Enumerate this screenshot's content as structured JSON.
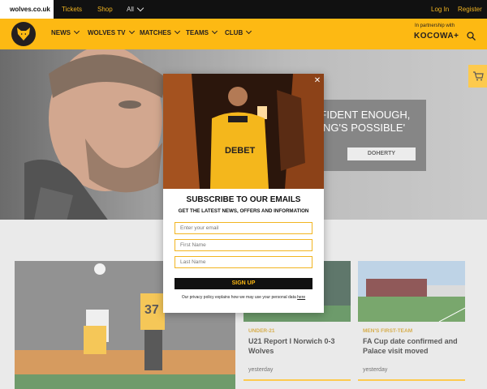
{
  "topbar": {
    "site": "wolves.co.uk",
    "links": [
      "Tickets",
      "Shop",
      "All"
    ],
    "login": "Log In",
    "register": "Register"
  },
  "nav": {
    "items": [
      "NEWS",
      "WOLVES TV",
      "MATCHES",
      "TEAMS",
      "CLUB"
    ],
    "partner_text": "In partnership with",
    "partner_name": "KOCOWA+",
    "icons": [
      "wolf-logo-icon",
      "search-icon",
      "cart-icon"
    ]
  },
  "hero": {
    "title_line1": "NFIDENT ENOUGH,",
    "title_line2": "HING'S POSSIBLE'",
    "button": "DOHERTY"
  },
  "modal": {
    "shirt_text": "DEBET",
    "title": "SUBSCRIBE TO OUR EMAILS",
    "subtitle": "GET THE LATEST NEWS, OFFERS AND INFORMATION",
    "email_placeholder": "Enter your email",
    "first_name_placeholder": "First Name",
    "last_name_placeholder": "Last Name",
    "signup": "SIGN UP",
    "privacy_text": "Our privacy policy explains how we may use your personal data",
    "privacy_link": "here",
    "close": "✕"
  },
  "news": {
    "big_card_number": "37",
    "cards": [
      {
        "category": "UNDER-21",
        "title": "U21 Report I Norwich 0-3 Wolves",
        "time": "yesterday"
      },
      {
        "category": "MEN'S FIRST-TEAM",
        "title": "FA Cup date confirmed and Palace visit moved",
        "time": "yesterday"
      }
    ]
  },
  "colors": {
    "gold": "#fdb913",
    "black": "#231f20"
  }
}
